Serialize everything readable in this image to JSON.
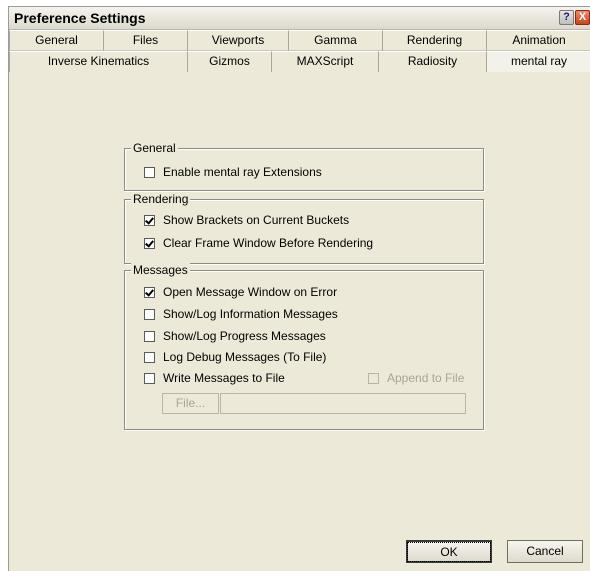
{
  "window": {
    "title": "Preference Settings"
  },
  "titlebar_buttons": {
    "help": "?",
    "close": "X"
  },
  "tabs_row1": [
    "General",
    "Files",
    "Viewports",
    "Gamma",
    "Rendering",
    "Animation"
  ],
  "tabs_row2": [
    "Inverse Kinematics",
    "Gizmos",
    "MAXScript",
    "Radiosity",
    "mental ray"
  ],
  "active_tab": "mental ray",
  "groups": {
    "general": {
      "title": "General",
      "items": [
        {
          "label": "Enable mental ray Extensions",
          "checked": false
        }
      ]
    },
    "rendering": {
      "title": "Rendering",
      "items": [
        {
          "label": "Show Brackets on Current Buckets",
          "checked": true
        },
        {
          "label": "Clear Frame Window Before Rendering",
          "checked": true
        }
      ]
    },
    "messages": {
      "title": "Messages",
      "items": [
        {
          "label": "Open Message Window on Error",
          "checked": true
        },
        {
          "label": "Show/Log Information Messages",
          "checked": false
        },
        {
          "label": "Show/Log Progress Messages",
          "checked": false
        },
        {
          "label": "Log Debug Messages (To File)",
          "checked": false
        },
        {
          "label": "Write Messages to File",
          "checked": false
        }
      ],
      "append": {
        "label": "Append to File",
        "checked": false,
        "enabled": false
      },
      "file_button": "File...",
      "file_path": ""
    }
  },
  "buttons": {
    "ok": "OK",
    "cancel": "Cancel"
  }
}
